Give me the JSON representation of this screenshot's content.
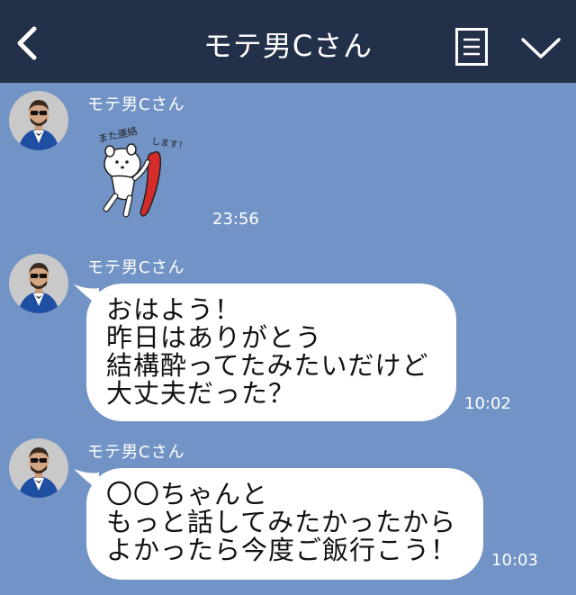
{
  "header": {
    "title": "モテ男Cさん"
  },
  "messages": [
    {
      "sender": "モテ男Cさん",
      "type": "sticker",
      "sticker_text_1": "また連絡",
      "sticker_text_2": "します！",
      "time": "23:56"
    },
    {
      "sender": "モテ男Cさん",
      "type": "text",
      "lines": [
        "おはよう！",
        "昨日はありがとう",
        "結構酔ってたみたいだけど",
        "大丈夫だった？"
      ],
      "time": "10:02"
    },
    {
      "sender": "モテ男Cさん",
      "type": "text",
      "lines": [
        "〇〇ちゃんと",
        "もっと話してみたかったから",
        "よかったら今度ご飯行こう！"
      ],
      "time": "10:03"
    }
  ],
  "colors": {
    "header_bg": "#233049",
    "chat_bg": "#7293c5",
    "bubble_bg": "#ffffff"
  }
}
